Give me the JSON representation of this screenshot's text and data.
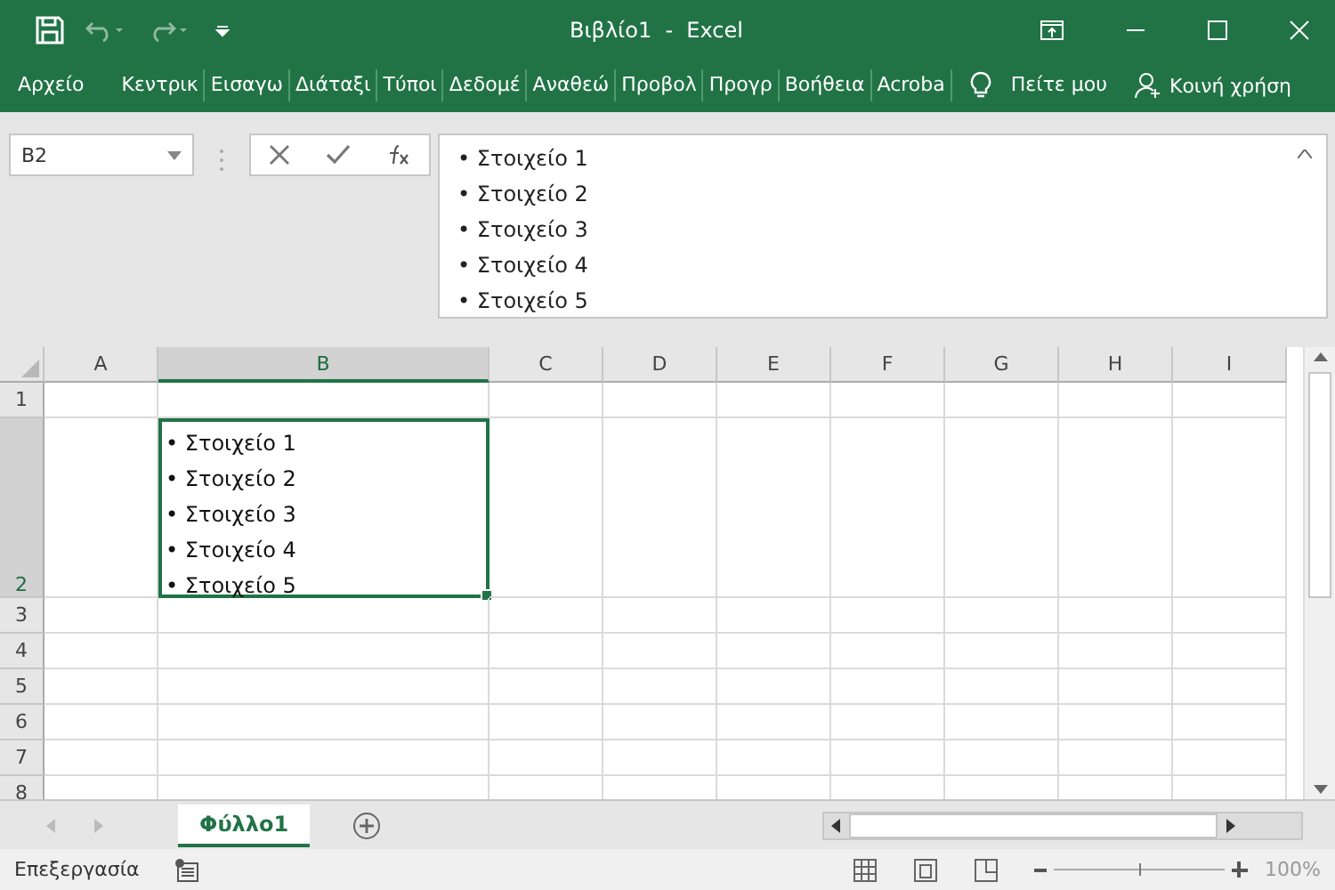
{
  "window": {
    "title": "Βιβλίο1  -  Excel"
  },
  "ribbon": {
    "tabs": [
      {
        "label": "Αρχείο",
        "kind": "file"
      },
      {
        "label": "Κεντρικ",
        "kind": "tab"
      },
      {
        "label": "Εισαγω",
        "kind": "tab"
      },
      {
        "label": "Διάταξι",
        "kind": "tab"
      },
      {
        "label": "Τύποι",
        "kind": "tab"
      },
      {
        "label": "Δεδομέ",
        "kind": "tab"
      },
      {
        "label": "Αναθεώ",
        "kind": "tab"
      },
      {
        "label": "Προβολ",
        "kind": "tab"
      },
      {
        "label": "Προγρ",
        "kind": "tab"
      },
      {
        "label": "Βοήθεια",
        "kind": "tab"
      },
      {
        "label": "Acroba",
        "kind": "tab"
      }
    ],
    "tell_me": "Πείτε μου",
    "share": "Κοινή χρήση"
  },
  "formula_bar": {
    "name_box": "B2",
    "lines": [
      "• Στοιχείο 1",
      "• Στοιχείο 2",
      "• Στοιχείο 3",
      "• Στοιχείο 4",
      "• Στοιχείο 5"
    ]
  },
  "sheet": {
    "columns": [
      {
        "label": "A",
        "selected": false
      },
      {
        "label": "B",
        "selected": true
      },
      {
        "label": "C",
        "selected": false
      },
      {
        "label": "D",
        "selected": false
      },
      {
        "label": "E",
        "selected": false
      },
      {
        "label": "F",
        "selected": false
      },
      {
        "label": "G",
        "selected": false
      },
      {
        "label": "H",
        "selected": false
      },
      {
        "label": "I",
        "selected": false
      }
    ],
    "rows": [
      {
        "label": "1",
        "selected": false
      },
      {
        "label": "2",
        "selected": true,
        "content": [
          "• Στοιχείο 1",
          "• Στοιχείο 2",
          "• Στοιχείο 3",
          "• Στοιχείο 4",
          "• Στοιχείο 5"
        ]
      },
      {
        "label": "3",
        "selected": false
      },
      {
        "label": "4",
        "selected": false
      },
      {
        "label": "5",
        "selected": false
      },
      {
        "label": "6",
        "selected": false
      },
      {
        "label": "7",
        "selected": false
      },
      {
        "label": "8",
        "selected": false
      }
    ]
  },
  "sheet_tabs": [
    {
      "label": "Φύλλο1",
      "selected": true
    }
  ],
  "status_bar": {
    "mode": "Επεξεργασία",
    "zoom_slider": {
      "level": 0.5
    },
    "zoom": "100%"
  }
}
